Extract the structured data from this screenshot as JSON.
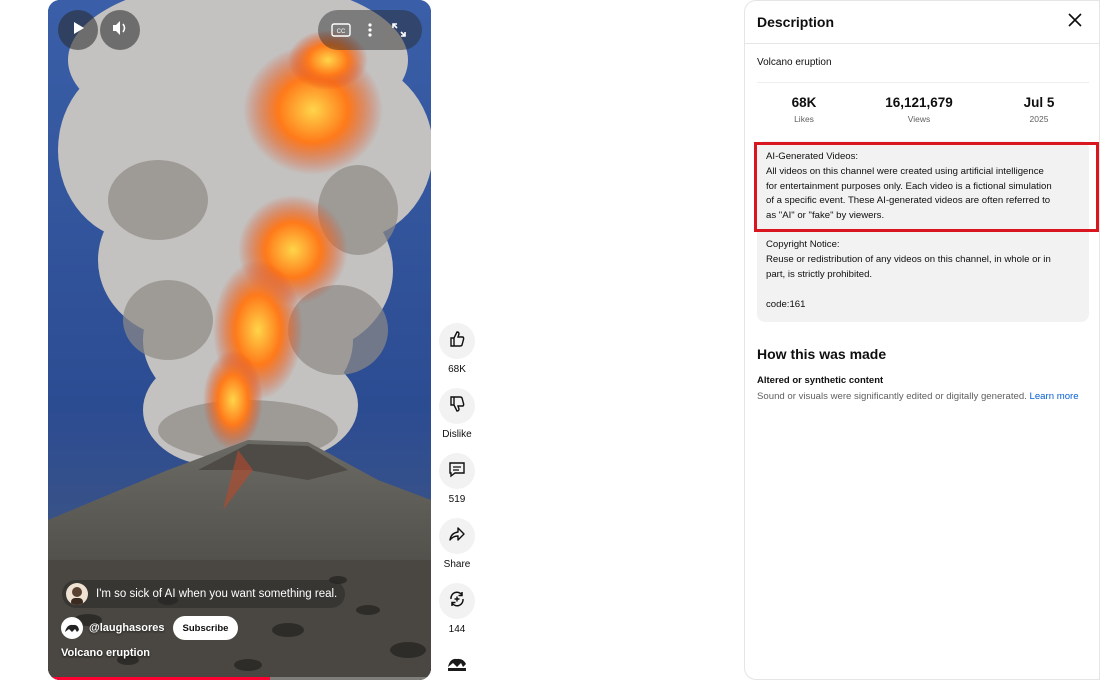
{
  "player": {
    "comment_text": "I'm so sick of AI when you want something real.",
    "channel_handle": "@laughasores",
    "subscribe_label": "Subscribe",
    "video_title": "Volcano eruption",
    "progress": 0.58,
    "icons": [
      "play-icon",
      "volume-icon",
      "captions-icon",
      "more-vert-icon",
      "fullscreen-icon"
    ]
  },
  "actions": {
    "like_count": "68K",
    "dislike_label": "Dislike",
    "comment_count": "519",
    "share_label": "Share",
    "remix_count": "144"
  },
  "description": {
    "header_title": "Description",
    "video_title": "Volcano eruption",
    "stats": [
      {
        "value": "68K",
        "label": "Likes"
      },
      {
        "value": "16,121,679",
        "label": "Views"
      },
      {
        "value": "Jul 5",
        "label": "2025"
      }
    ],
    "ai_notice_lines": [
      "AI-Generated Videos:",
      "All videos on this channel were created using artificial intelligence",
      "for entertainment purposes only. Each video is a fictional simulation",
      "of a specific event. These AI-generated videos are often referred to",
      "as \"AI\" or \"fake\" by viewers."
    ],
    "copyright_lines": [
      "Copyright Notice:",
      "Reuse or redistribution of any videos on this channel, in whole or in",
      "part, is strictly prohibited."
    ],
    "code": "code:161",
    "highlight_color": "#d9161f"
  },
  "how_made": {
    "title": "How this was made",
    "subtitle": "Altered or synthetic content",
    "text": "Sound or visuals were significantly edited or digitally generated.",
    "learn_more": "Learn more"
  }
}
